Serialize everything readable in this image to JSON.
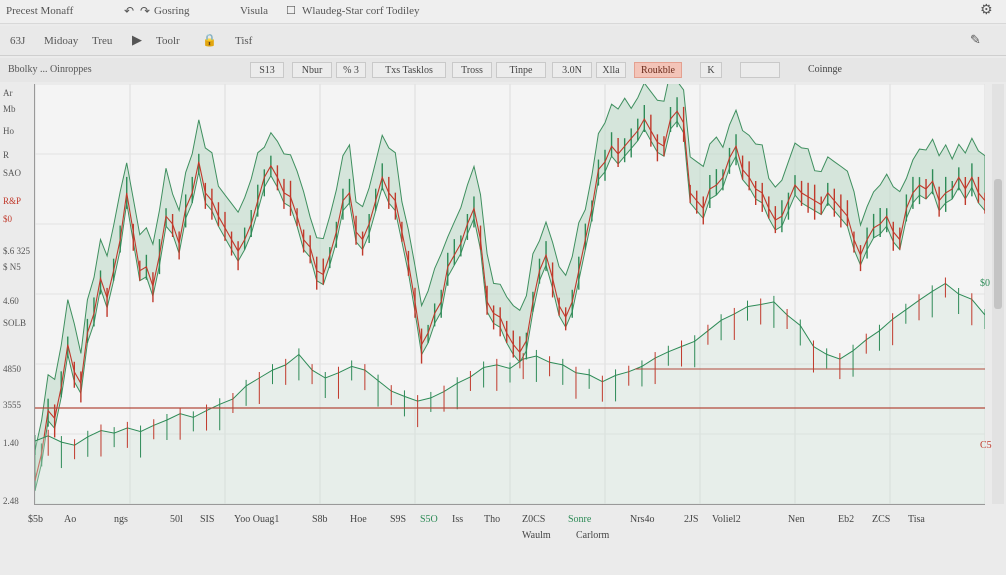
{
  "titlebar": {
    "app": "Precest Monaff",
    "item_gaming": "Gosring",
    "item_visual": "Visula",
    "item_window": "Wlaudeg-Star corf Todiley"
  },
  "toolbar": {
    "left": "63J",
    "items": [
      "Midoay",
      "Treu",
      "Toolr",
      "Tisf"
    ]
  },
  "subbar": {
    "label": "Bbolky ... Oinroppes",
    "cells": [
      "S13",
      "Nbur",
      "% 3",
      "Txs Tasklos",
      "Tross",
      "Tinpe",
      "3.0N",
      "Xlla",
      "Roukble",
      "K",
      "",
      "Coinnge"
    ],
    "highlight_index": 8
  },
  "y_labels": [
    "Ar",
    "Mb",
    "Ho",
    "R",
    "SAO",
    "$.6 325",
    "$ N5",
    "4.60",
    "SOLB",
    "4850",
    "3555",
    "1.40",
    "2.48"
  ],
  "y_labels_red": [
    "R&P",
    "$0"
  ],
  "right_labels": [
    "$0",
    "C5"
  ],
  "x_labels": [
    "$5b",
    "Ao",
    "ngs",
    "50l",
    "SIS",
    "Yoo Ouag1",
    "S8b",
    "Hoe",
    "S9S",
    "S5O",
    "Iss",
    "Tho",
    "Z0CS",
    "Sonre",
    "Nrs4o",
    "2JS",
    "Voliel2",
    "Nen",
    "Eb2",
    "ZCS",
    "Tisa"
  ],
  "x_labels_green": [
    9,
    13
  ],
  "x_sub": [
    "Waulm",
    "Carlorm"
  ],
  "chart_data": {
    "type": "line",
    "series": [
      {
        "values": [
          330,
          365,
          420,
          410,
          450,
          505,
          470,
          455,
          520,
          545,
          590,
          565,
          600,
          640,
          700,
          650,
          600,
          605,
          580,
          620,
          670,
          660,
          635,
          680,
          700,
          740,
          700,
          690,
          670,
          655,
          640,
          625,
          640,
          660,
          690,
          720,
          735,
          720,
          700,
          695,
          670,
          640,
          630,
          600,
          595,
          620,
          650,
          690,
          700,
          650,
          640,
          660,
          690,
          720,
          700,
          690,
          650,
          610,
          560,
          505,
          520,
          545,
          560,
          605,
          620,
          635,
          660,
          680,
          640,
          560,
          545,
          540,
          520,
          505,
          495,
          510,
          560,
          600,
          620,
          590,
          555,
          540,
          560,
          600,
          640,
          680,
          730,
          740,
          760,
          750,
          760,
          770,
          780,
          795,
          780,
          765,
          760,
          795,
          805,
          790,
          700,
          690,
          680,
          705,
          710,
          720,
          745,
          760,
          730,
          720,
          705,
          700,
          680,
          665,
          670,
          690,
          710,
          700,
          695,
          690,
          685,
          700,
          690,
          680,
          670,
          640,
          620,
          640,
          655,
          660,
          670,
          650,
          640,
          680,
          700,
          710,
          705,
          715,
          690,
          700,
          705,
          720,
          705,
          720,
          700,
          690
        ]
      },
      {
        "values": [
          120,
          130,
          118,
          112,
          128,
          140,
          135,
          145,
          138,
          150,
          160,
          172,
          165,
          178,
          190,
          200,
          225,
          240,
          255,
          265,
          285,
          255,
          240,
          250,
          262,
          255,
          235,
          215,
          205,
          196,
          202,
          214,
          230,
          242,
          260,
          265,
          258,
          276,
          282,
          270,
          265,
          250,
          246,
          233,
          245,
          252,
          262,
          278,
          290,
          300,
          310,
          330,
          350,
          362,
          376,
          380,
          385,
          360,
          340,
          300,
          285,
          276,
          292,
          313,
          330,
          352,
          370,
          388,
          405,
          420,
          400,
          390,
          360
        ]
      }
    ]
  }
}
